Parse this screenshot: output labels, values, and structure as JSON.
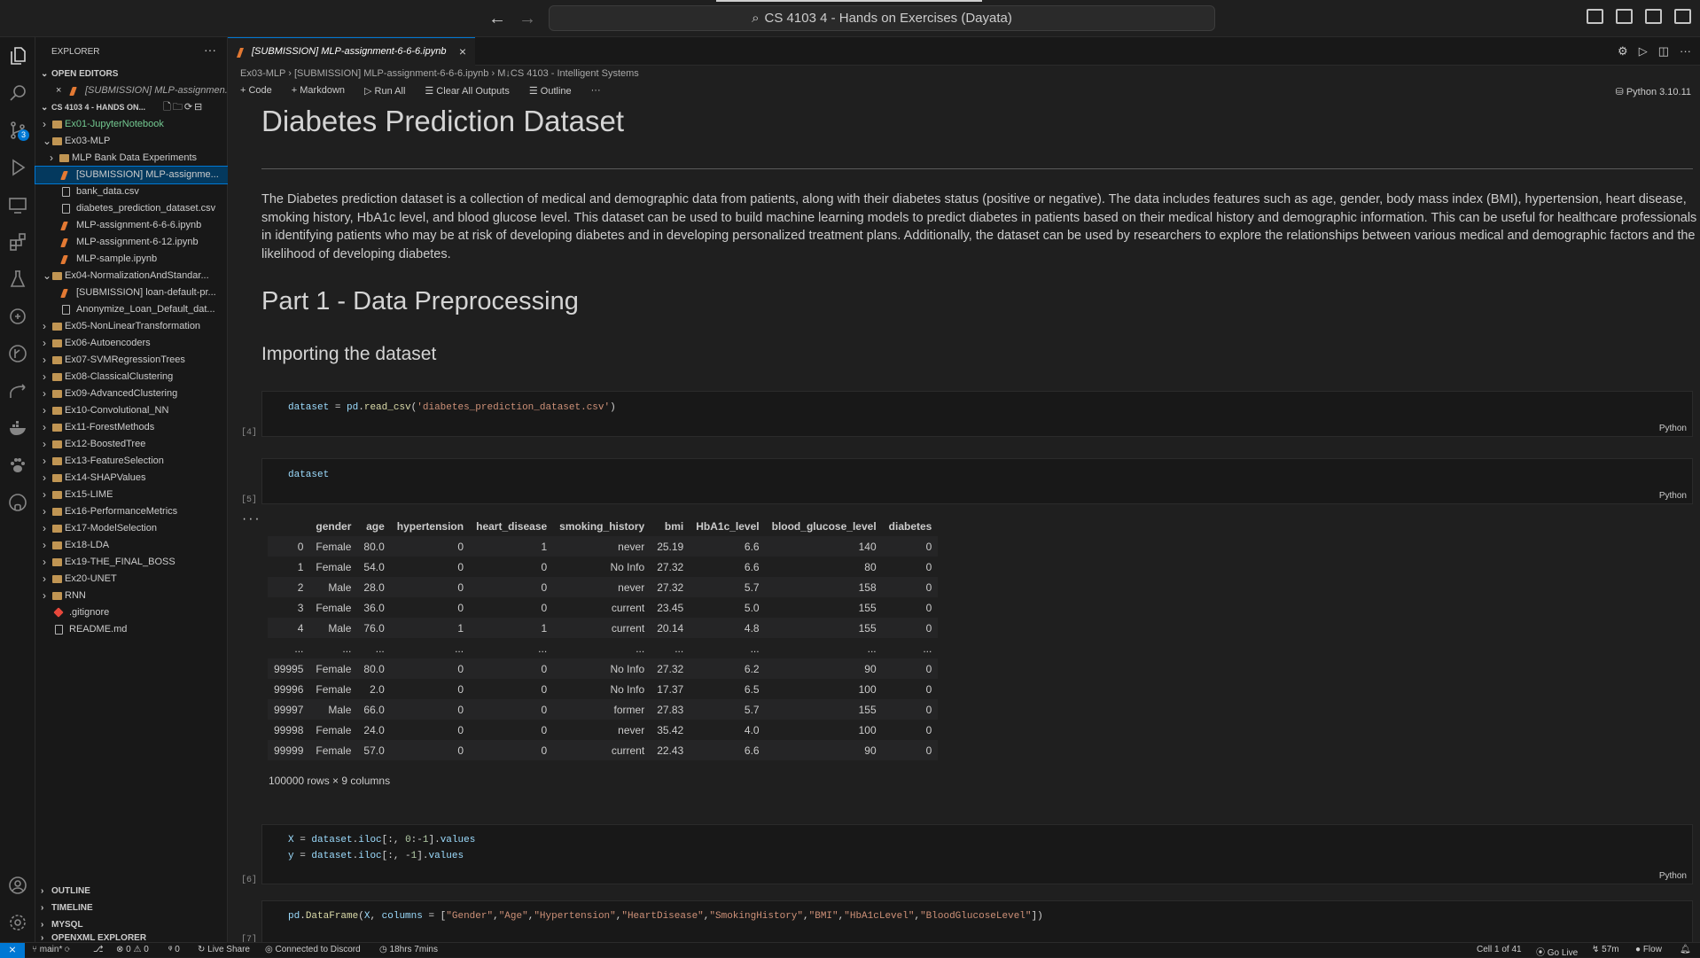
{
  "title_bar": {
    "command_center": "CS 4103 4 - Hands on Exercises (Dayata)"
  },
  "activity_badge": "3",
  "sidebar": {
    "title": "EXPLORER",
    "open_editors_label": "OPEN EDITORS",
    "open_editor_item": "[SUBMISSION] MLP-assignmen...",
    "workspace_label": "CS 4103 4 - HANDS ON...",
    "tree": [
      {
        "label": "Ex01-JupyterNotebook",
        "level": 1,
        "type": "folder",
        "collapsed": true,
        "color": "#73c991"
      },
      {
        "label": "Ex03-MLP",
        "level": 1,
        "type": "folder",
        "collapsed": false
      },
      {
        "label": "MLP Bank Data Experiments",
        "level": 2,
        "type": "folder",
        "collapsed": true
      },
      {
        "label": "[SUBMISSION] MLP-assignme...",
        "level": 2,
        "type": "notebook",
        "selected": true
      },
      {
        "label": "bank_data.csv",
        "level": 2,
        "type": "file"
      },
      {
        "label": "diabetes_prediction_dataset.csv",
        "level": 2,
        "type": "file"
      },
      {
        "label": "MLP-assignment-6-6-6.ipynb",
        "level": 2,
        "type": "notebook"
      },
      {
        "label": "MLP-assignment-6-12.ipynb",
        "level": 2,
        "type": "notebook"
      },
      {
        "label": "MLP-sample.ipynb",
        "level": 2,
        "type": "notebook"
      },
      {
        "label": "Ex04-NormalizationAndStandar...",
        "level": 1,
        "type": "folder",
        "collapsed": false
      },
      {
        "label": "[SUBMISSION] loan-default-pr...",
        "level": 2,
        "type": "notebook"
      },
      {
        "label": "Anonymize_Loan_Default_dat...",
        "level": 2,
        "type": "file"
      },
      {
        "label": "Ex05-NonLinearTransformation",
        "level": 1,
        "type": "folder",
        "collapsed": true
      },
      {
        "label": "Ex06-Autoencoders",
        "level": 1,
        "type": "folder",
        "collapsed": true
      },
      {
        "label": "Ex07-SVMRegressionTrees",
        "level": 1,
        "type": "folder",
        "collapsed": true
      },
      {
        "label": "Ex08-ClassicalClustering",
        "level": 1,
        "type": "folder",
        "collapsed": true
      },
      {
        "label": "Ex09-AdvancedClustering",
        "level": 1,
        "type": "folder",
        "collapsed": true
      },
      {
        "label": "Ex10-Convolutional_NN",
        "level": 1,
        "type": "folder",
        "collapsed": true
      },
      {
        "label": "Ex11-ForestMethods",
        "level": 1,
        "type": "folder",
        "collapsed": true
      },
      {
        "label": "Ex12-BoostedTree",
        "level": 1,
        "type": "folder",
        "collapsed": true
      },
      {
        "label": "Ex13-FeatureSelection",
        "level": 1,
        "type": "folder",
        "collapsed": true
      },
      {
        "label": "Ex14-SHAPValues",
        "level": 1,
        "type": "folder",
        "collapsed": true
      },
      {
        "label": "Ex15-LIME",
        "level": 1,
        "type": "folder",
        "collapsed": true
      },
      {
        "label": "Ex16-PerformanceMetrics",
        "level": 1,
        "type": "folder",
        "collapsed": true
      },
      {
        "label": "Ex17-ModelSelection",
        "level": 1,
        "type": "folder",
        "collapsed": true
      },
      {
        "label": "Ex18-LDA",
        "level": 1,
        "type": "folder",
        "collapsed": true
      },
      {
        "label": "Ex19-THE_FINAL_BOSS",
        "level": 1,
        "type": "folder",
        "collapsed": true
      },
      {
        "label": "Ex20-UNET",
        "level": 1,
        "type": "folder",
        "collapsed": true
      },
      {
        "label": "RNN",
        "level": 1,
        "type": "folder",
        "collapsed": true
      },
      {
        "label": ".gitignore",
        "level": 1,
        "type": "git"
      },
      {
        "label": "README.md",
        "level": 1,
        "type": "file"
      }
    ],
    "sections": [
      "OUTLINE",
      "TIMELINE",
      "MYSQL",
      "OPENXML EXPLORER"
    ]
  },
  "tab": {
    "label": "[SUBMISSION] MLP-assignment-6-6-6.ipynb",
    "close": "×"
  },
  "breadcrumbs": [
    "Ex03-MLP",
    "[SUBMISSION] MLP-assignment-6-6-6.ipynb",
    "M↓CS 4103 - Intelligent Systems"
  ],
  "toolbar": {
    "code": "+ Code",
    "markdown": "+ Markdown",
    "run_all": "▷ Run All",
    "clear": "☰ Clear All Outputs",
    "outline": "☰ Outline",
    "more": "···"
  },
  "kernel": "Python 3.10.11",
  "notebook": {
    "title": "Diabetes Prediction Dataset",
    "description": "The Diabetes prediction dataset is a collection of medical and demographic data from patients, along with their diabetes status (positive or negative). The data includes features such as age, gender, body mass index (BMI), hypertension, heart disease, smoking history, HbA1c level, and blood glucose level. This dataset can be used to build machine learning models to predict diabetes in patients based on their medical history and demographic information. This can be useful for healthcare professionals in identifying patients who may be at risk of developing diabetes and in developing personalized treatment plans. Additionally, the dataset can be used by researchers to explore the relationships between various medical and demographic factors and the likelihood of developing diabetes.",
    "part1": "Part 1 - Data Preprocessing",
    "importing": "Importing the dataset",
    "lang": "Python",
    "cells": [
      {
        "num": "[4]",
        "code": "dataset = pd.read_csv('diabetes_prediction_dataset.csv')"
      },
      {
        "num": "[5]",
        "code": "dataset"
      },
      {
        "num": "[6]",
        "code": "X = dataset.iloc[:, 0:-1].values\ny = dataset.iloc[:, -1].values"
      },
      {
        "num": "[7]",
        "code": "pd.DataFrame(X, columns = [\"Gender\",\"Age\",\"Hypertension\",\"HeartDisease\",\"SmokingHistory\",\"BMI\",\"HbA1cLevel\",\"BloodGlucoseLevel\"])"
      }
    ],
    "output_more": "···",
    "df_columns": [
      "",
      "gender",
      "age",
      "hypertension",
      "heart_disease",
      "smoking_history",
      "bmi",
      "HbA1c_level",
      "blood_glucose_level",
      "diabetes"
    ],
    "df_rows": [
      [
        "0",
        "Female",
        "80.0",
        "0",
        "1",
        "never",
        "25.19",
        "6.6",
        "140",
        "0"
      ],
      [
        "1",
        "Female",
        "54.0",
        "0",
        "0",
        "No Info",
        "27.32",
        "6.6",
        "80",
        "0"
      ],
      [
        "2",
        "Male",
        "28.0",
        "0",
        "0",
        "never",
        "27.32",
        "5.7",
        "158",
        "0"
      ],
      [
        "3",
        "Female",
        "36.0",
        "0",
        "0",
        "current",
        "23.45",
        "5.0",
        "155",
        "0"
      ],
      [
        "4",
        "Male",
        "76.0",
        "1",
        "1",
        "current",
        "20.14",
        "4.8",
        "155",
        "0"
      ],
      [
        "...",
        "...",
        "...",
        "...",
        "...",
        "...",
        "...",
        "...",
        "...",
        "..."
      ],
      [
        "99995",
        "Female",
        "80.0",
        "0",
        "0",
        "No Info",
        "27.32",
        "6.2",
        "90",
        "0"
      ],
      [
        "99996",
        "Female",
        "2.0",
        "0",
        "0",
        "No Info",
        "17.37",
        "6.5",
        "100",
        "0"
      ],
      [
        "99997",
        "Male",
        "66.0",
        "0",
        "0",
        "former",
        "27.83",
        "5.7",
        "155",
        "0"
      ],
      [
        "99998",
        "Female",
        "24.0",
        "0",
        "0",
        "never",
        "35.42",
        "4.0",
        "100",
        "0"
      ],
      [
        "99999",
        "Female",
        "57.0",
        "0",
        "0",
        "current",
        "22.43",
        "6.6",
        "90",
        "0"
      ]
    ],
    "df_shape": "100000 rows × 9 columns"
  },
  "statusbar": {
    "branch": "main*",
    "errors": "⊗ 0 ⚠ 0",
    "ports": "0",
    "live_share": "Live Share",
    "discord": "Connected to Discord",
    "time": "18hrs 7mins",
    "cell": "Cell 1 of 41",
    "go_live": "Go Live",
    "timer": "57m",
    "flow": "Flow"
  }
}
